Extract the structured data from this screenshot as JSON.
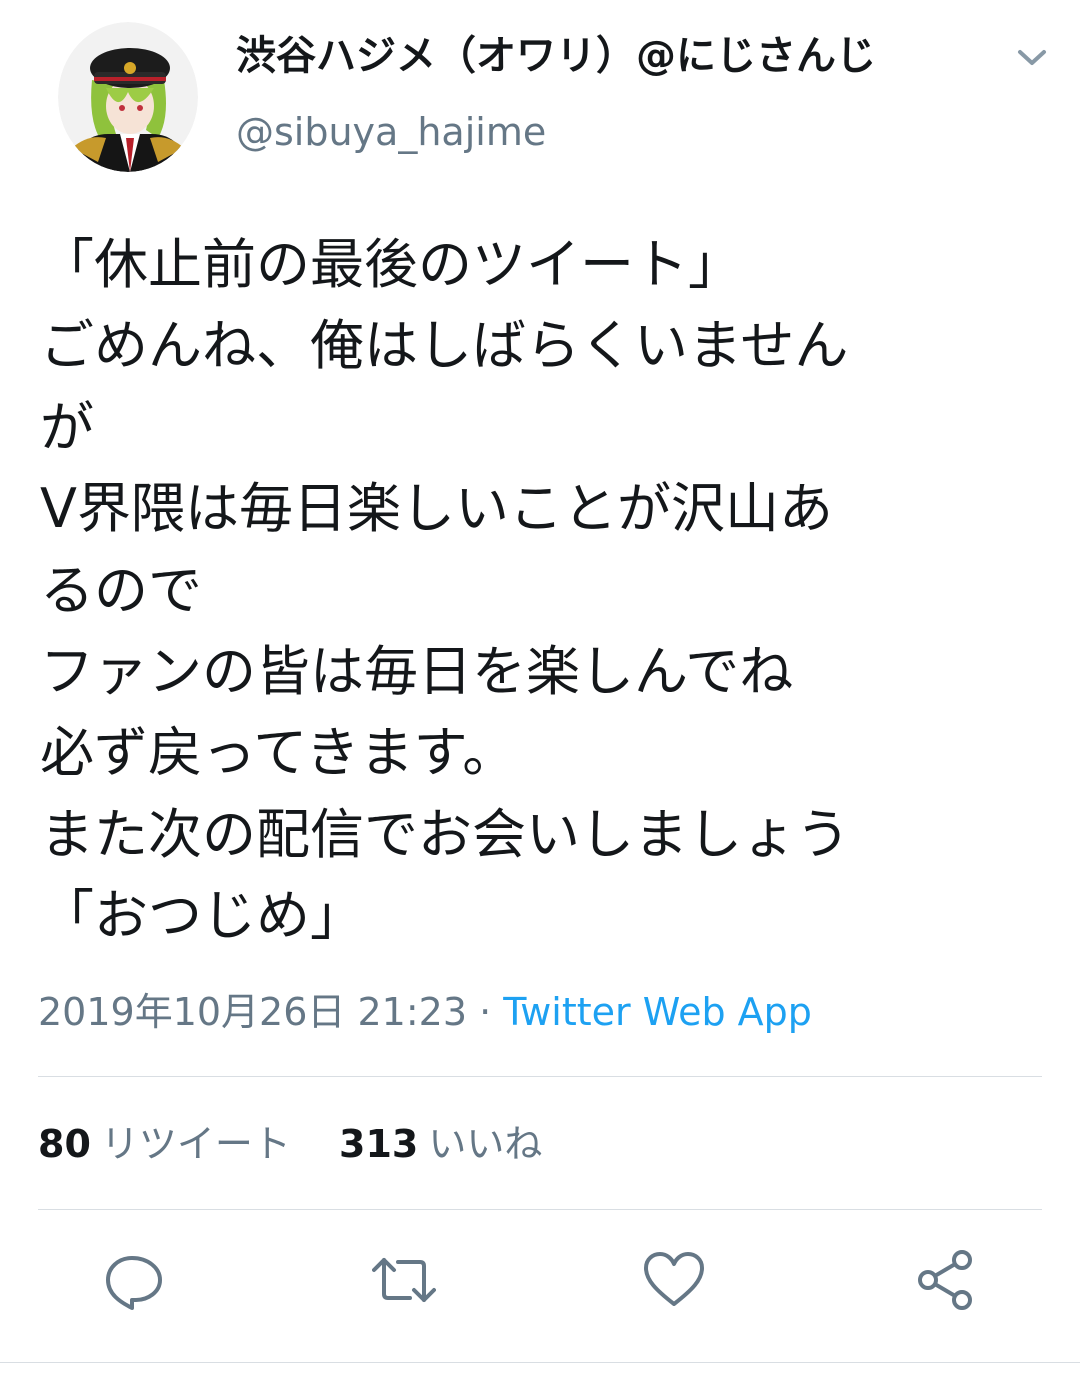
{
  "user": {
    "display_name": "渋谷ハジメ（オワリ）@にじさんじ",
    "handle": "@sibuya_hajime"
  },
  "tweet": {
    "lines": [
      "「休止前の最後のツイート」",
      "ごめんね、俺はしばらくいません",
      "が",
      "V界隈は毎日楽しいことが沢山あ",
      "るので",
      "ファンの皆は毎日を楽しんでね",
      "必ず戻ってきます。",
      "また次の配信でお会いしましょう",
      "「おつじめ」"
    ],
    "timestamp": "2019年10月26日 21:23",
    "separator": "·",
    "source": "Twitter Web App"
  },
  "stats": {
    "retweets": {
      "count": "80",
      "label": "リツイート"
    },
    "likes": {
      "count": "313",
      "label": "いいね"
    }
  },
  "actions": [
    {
      "name": "reply-button",
      "icon": "reply-icon"
    },
    {
      "name": "retweet-button",
      "icon": "retweet-icon"
    },
    {
      "name": "like-button",
      "icon": "heart-icon"
    },
    {
      "name": "share-button",
      "icon": "share-icon"
    }
  ],
  "colors": {
    "text": "#14171a",
    "secondary": "#657786",
    "link": "#1da1f2",
    "divider": "#d9dee3"
  }
}
